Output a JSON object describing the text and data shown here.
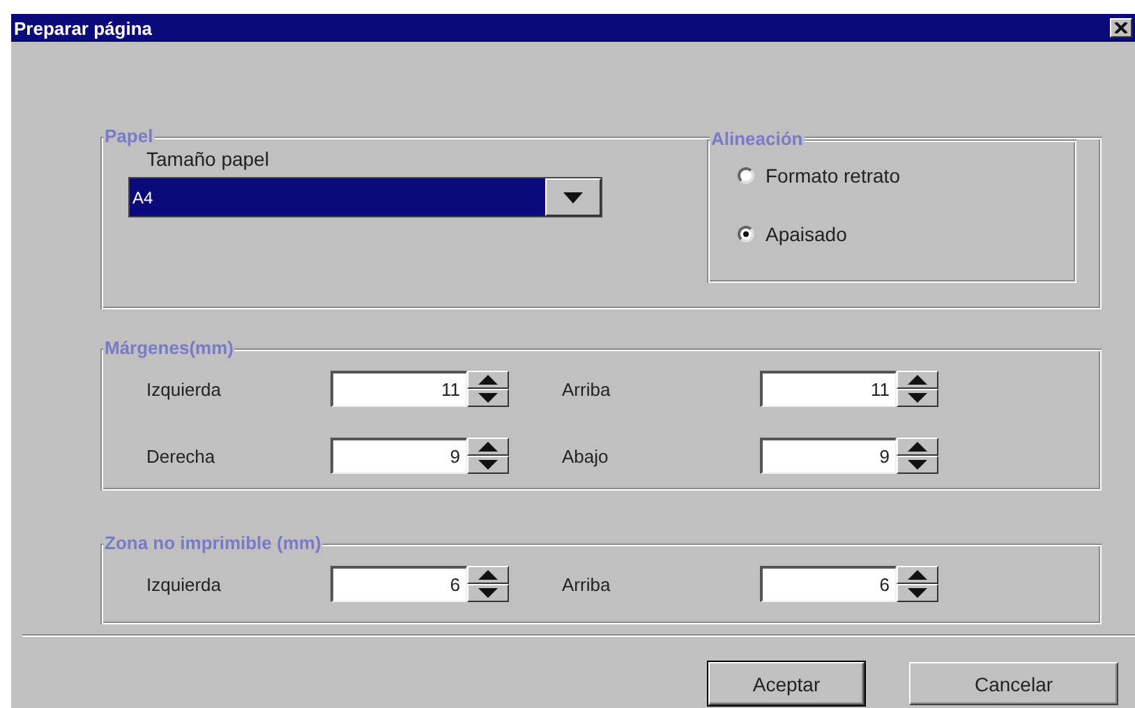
{
  "window": {
    "title": "Preparar página"
  },
  "paper": {
    "legend": "Papel",
    "size_label": "Tamaño papel",
    "size_value": "A4",
    "orientation": {
      "legend": "Alineación",
      "options": [
        {
          "label": "Formato retrato",
          "selected": false
        },
        {
          "label": "Apaisado",
          "selected": true
        }
      ]
    }
  },
  "margins": {
    "legend": "Márgenes(mm)",
    "fields": [
      {
        "label": "Izquierda",
        "value": "11"
      },
      {
        "label": "Arriba",
        "value": "11"
      },
      {
        "label": "Derecha",
        "value": "9"
      },
      {
        "label": "Abajo",
        "value": "9"
      }
    ]
  },
  "non_printable": {
    "legend": "Zona no imprimible (mm)",
    "fields": [
      {
        "label": "Izquierda",
        "value": "6"
      },
      {
        "label": "Arriba",
        "value": "6"
      }
    ]
  },
  "buttons": [
    {
      "label": "Aceptar",
      "default": true
    },
    {
      "label": "Cancelar",
      "default": false
    }
  ]
}
